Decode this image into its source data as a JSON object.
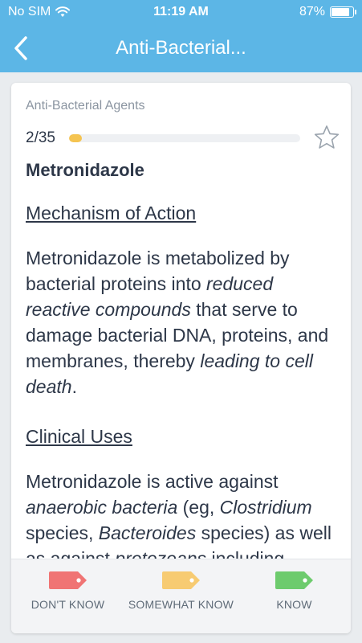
{
  "status_bar": {
    "carrier": "No SIM",
    "time": "11:19 AM",
    "battery": "87%",
    "battery_level": 0.87
  },
  "nav": {
    "title": "Anti-Bacterial..."
  },
  "card": {
    "category": "Anti-Bacterial Agents",
    "progress": {
      "label": "2/35",
      "current": 2,
      "total": 35
    },
    "drug_name": "Metronidazole",
    "mechanism": {
      "title": "Mechanism of Action",
      "t1": "Metronidazole is metabolized by bacterial proteins into ",
      "e1": "reduced reactive compounds",
      "t2": " that serve to damage bacterial DNA, proteins, and membranes, thereby ",
      "e2": "leading to cell death",
      "t3": "."
    },
    "clinical": {
      "title": "Clinical Uses",
      "t1": "Metronidazole is active against ",
      "e1": "anaerobic bacteria",
      "t2": " (eg, ",
      "e2": "Clostridium",
      "t3": " species, ",
      "e3": "Bacteroides",
      "t4": " species) as well as against ",
      "e4": "protozoans",
      "t5": " including"
    }
  },
  "footer": {
    "dont_know": {
      "label": "DON'T KNOW",
      "color": "#f07474"
    },
    "somewhat_know": {
      "label": "SOMEWHAT KNOW",
      "color": "#f7cb72"
    },
    "know": {
      "label": "KNOW",
      "color": "#6dcb6d"
    }
  },
  "colors": {
    "header": "#5cb6e6",
    "progress": "#f5c451"
  }
}
